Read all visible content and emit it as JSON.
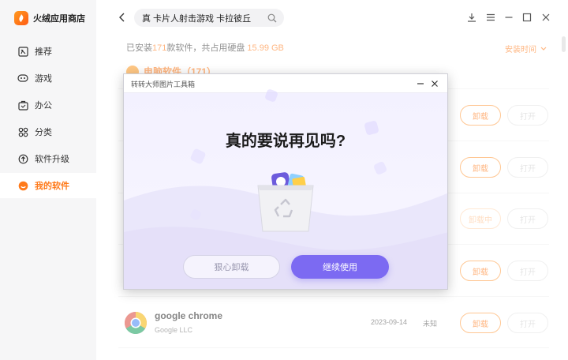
{
  "app": {
    "name": "火绒应用商店"
  },
  "sidebar": {
    "items": [
      {
        "label": "推荐",
        "icon": "recommend-icon",
        "active": false
      },
      {
        "label": "游戏",
        "icon": "gamepad-icon",
        "active": false
      },
      {
        "label": "办公",
        "icon": "briefcase-icon",
        "active": false
      },
      {
        "label": "分类",
        "icon": "grid-icon",
        "active": false
      },
      {
        "label": "软件升级",
        "icon": "upgrade-icon",
        "active": false
      },
      {
        "label": "我的软件",
        "icon": "my-software-icon",
        "active": true
      }
    ]
  },
  "search": {
    "query": "真  卡片人射击游戏  卡拉彼丘"
  },
  "summary": {
    "prefix": "已安装",
    "count": "171",
    "middle": "款软件，共占用硬盘 ",
    "size": "15.99 GB"
  },
  "sort": {
    "label": "安装时间"
  },
  "section": {
    "label": "电脑软件（171）"
  },
  "list": {
    "rows": [
      {
        "uninstall": "卸载",
        "open": "打开"
      },
      {
        "uninstall": "卸载",
        "open": "打开"
      },
      {
        "uninstall": "卸载中",
        "open": "打开"
      },
      {
        "uninstall": "卸载",
        "open": "打开"
      },
      {
        "name": "google chrome",
        "publisher": "Google LLC",
        "date": "2023-09-14",
        "size": "未知",
        "uninstall": "卸载",
        "open": "打开"
      }
    ]
  },
  "dialog": {
    "title": "转转大师图片工具箱",
    "heading": "真的要说再见吗?",
    "cancel_label": "狠心卸载",
    "confirm_label": "继续使用"
  },
  "colors": {
    "accent": "#ff7a1a",
    "dialog_primary": "#7c6af2"
  }
}
